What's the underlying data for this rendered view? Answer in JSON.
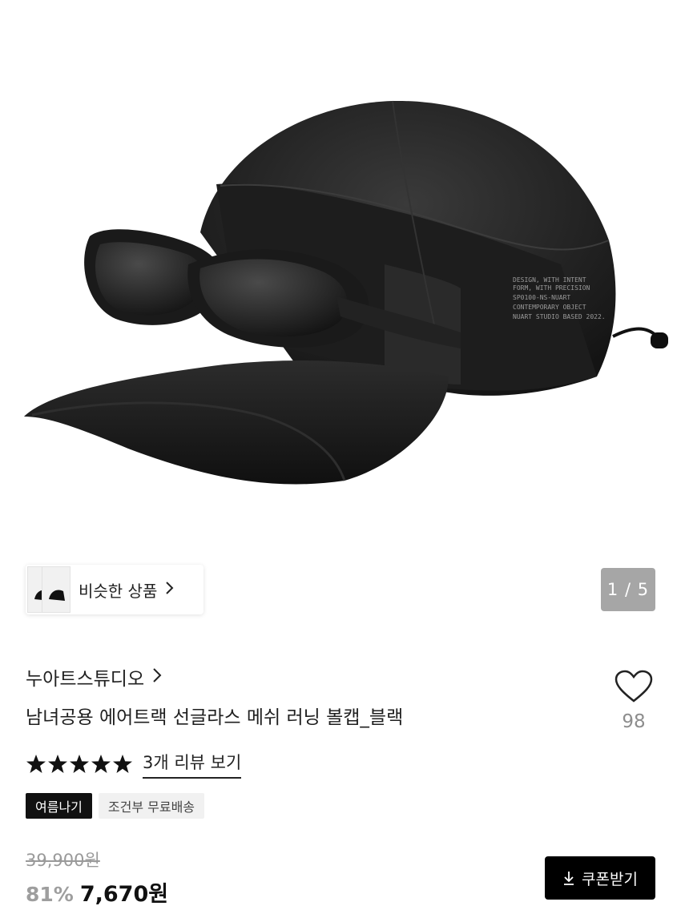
{
  "hero": {
    "cap_print_lines": [
      "DESIGN, WITH INTENT",
      "FORM, WITH PRECISION",
      "SP0100-NS-NUART",
      "CONTEMPORARY OBJECT",
      "NUART STUDIO BASED 2022."
    ]
  },
  "similar": {
    "label": "비슷한 상품",
    "icon": "chevron-right-icon"
  },
  "gallery": {
    "counter": "1 / 5"
  },
  "product": {
    "brand": "누아트스튜디오",
    "title": "남녀공용 에어트랙 선글라스 메쉬 러닝 볼캡_블랙",
    "rating_stars": 5,
    "review_link": "3개 리뷰 보기",
    "like_count": "98",
    "tags": [
      "여름나기",
      "조건부 무료배송"
    ],
    "original_price": "39,900원",
    "discount": "81%",
    "sale_price": "7,670원",
    "coupon_label": "쿠폰받기"
  },
  "colors": {
    "star": "#111111",
    "counter_bg": "#a6a6a6",
    "coupon_bg": "#000000",
    "discount": "#9e9e9e"
  }
}
